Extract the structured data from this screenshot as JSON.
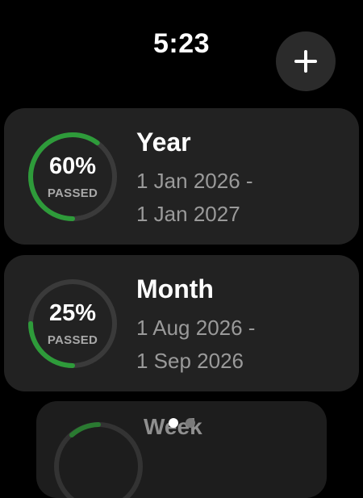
{
  "status_bar": {
    "time": "5:23"
  },
  "header": {
    "add_icon": "plus-icon"
  },
  "cards": [
    {
      "title": "Year",
      "percent_label": "60%",
      "passed_label": "PASSED",
      "progress": 0.6,
      "range_start": "1 Jan 2026 -",
      "range_end": "1 Jan 2027"
    },
    {
      "title": "Month",
      "percent_label": "25%",
      "passed_label": "PASSED",
      "progress": 0.25,
      "range_start": "1 Aug 2026 -",
      "range_end": "1 Sep 2026"
    },
    {
      "title": "Week"
    }
  ],
  "pagination": {
    "count": 2,
    "active": 0
  },
  "colors": {
    "background": "#000000",
    "card": "#222222",
    "ring_track": "#3a3a3a",
    "ring_progress": "#2e9b3a",
    "secondary_text": "#9a9a9a"
  }
}
